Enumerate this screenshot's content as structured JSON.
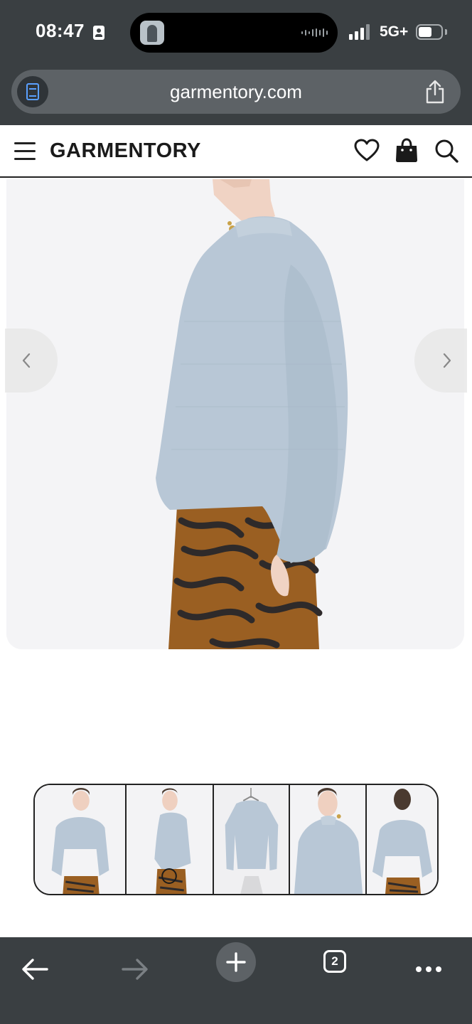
{
  "status_bar": {
    "time": "08:47",
    "network": "5G+",
    "icons": [
      "id-card-icon",
      "signal-icon",
      "battery-icon"
    ]
  },
  "browser": {
    "url": "garmentory.com",
    "reader_icon": "reader-mode-icon",
    "share_icon": "share-icon"
  },
  "site_header": {
    "logo": "GARMENTORY",
    "icons": [
      "menu-icon",
      "heart-icon",
      "bag-icon",
      "search-icon"
    ]
  },
  "gallery": {
    "prev_icon": "chevron-left-icon",
    "next_icon": "chevron-right-icon",
    "thumbnail_count": 5
  },
  "toolbar": {
    "tab_count": "2",
    "icons": [
      "back-arrow-icon",
      "forward-arrow-icon",
      "plus-icon",
      "tabs-icon",
      "more-icon"
    ]
  },
  "colors": {
    "chrome": "#3a3f42",
    "sweater": "#b8c7d6",
    "skirt": "#9a5f22",
    "skirt_stripe": "#2e2a2a"
  }
}
